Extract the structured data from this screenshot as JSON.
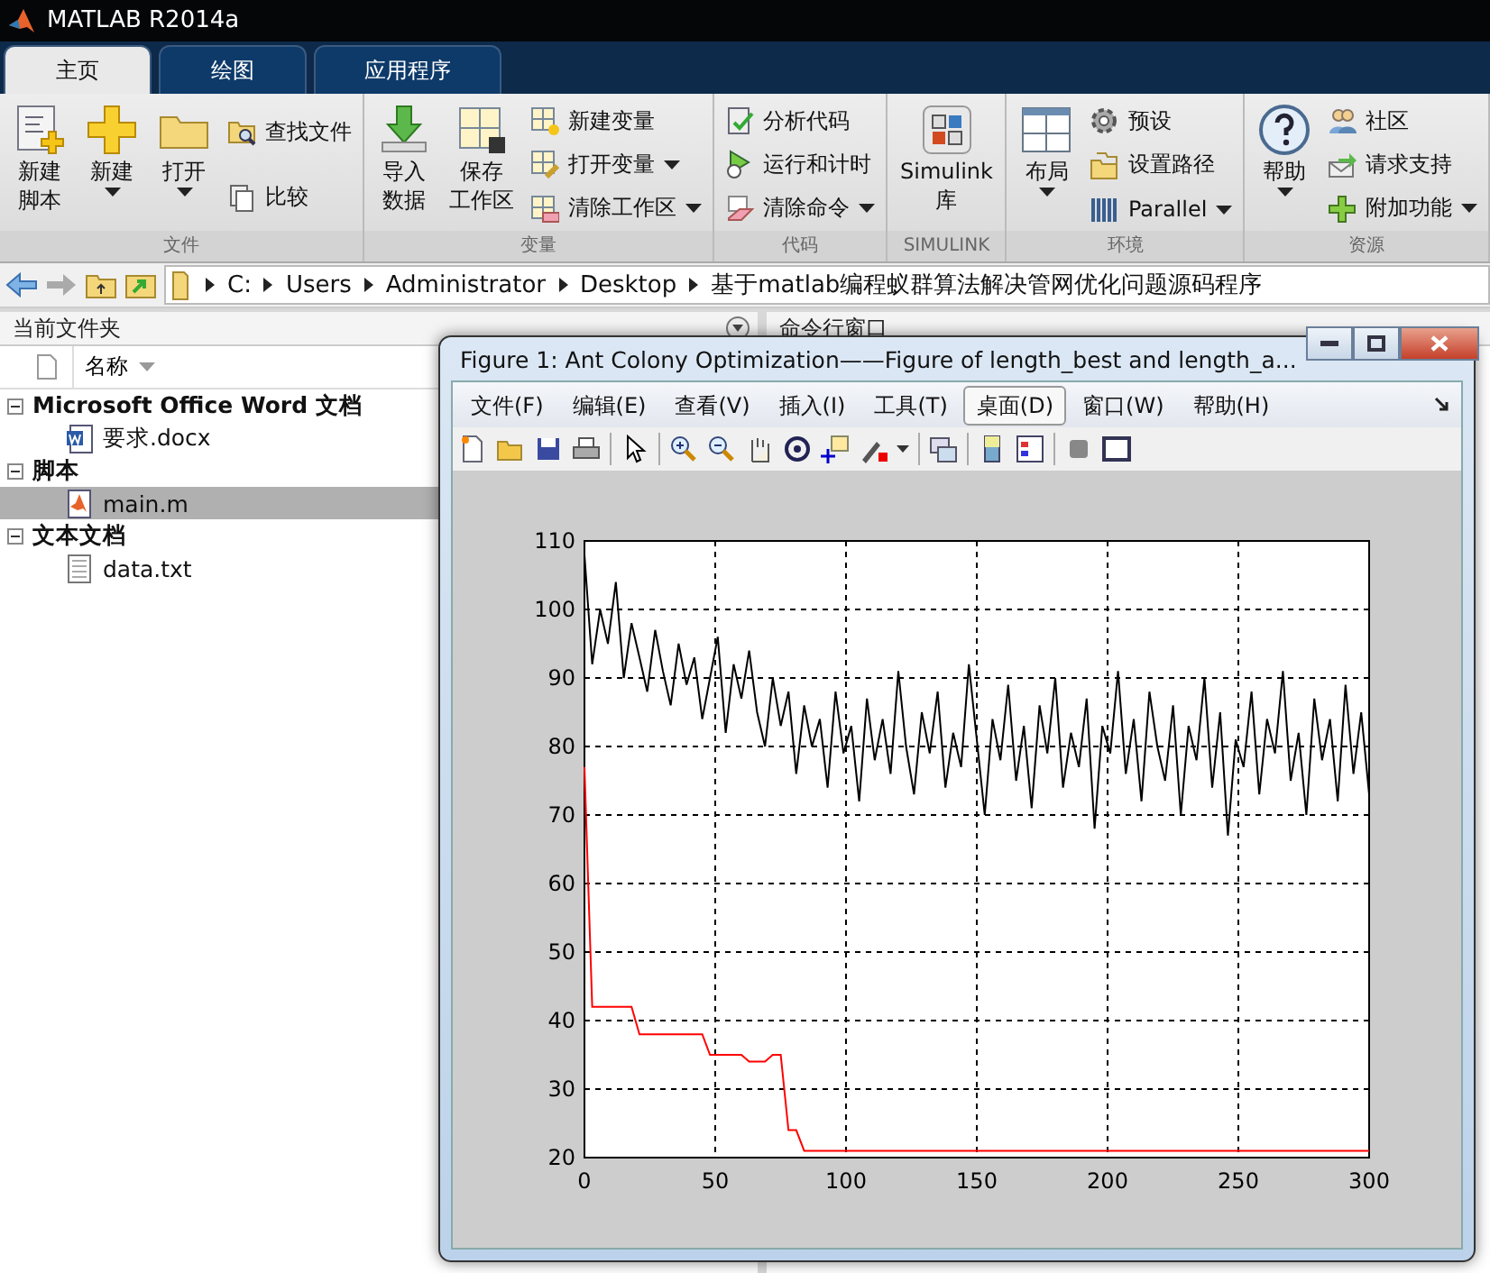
{
  "window": {
    "title": "MATLAB R2014a"
  },
  "tabs": [
    {
      "label": "主页",
      "selected": true
    },
    {
      "label": "绘图",
      "selected": false
    },
    {
      "label": "应用程序",
      "selected": false
    }
  ],
  "ribbon": {
    "groups": [
      {
        "label": "文件",
        "items": [
          {
            "lines": [
              "新建",
              "脚本"
            ],
            "kind": "large",
            "dropdown": false
          },
          {
            "lines": [
              "新建"
            ],
            "kind": "large",
            "dropdown": true
          },
          {
            "lines": [
              "打开"
            ],
            "kind": "large",
            "dropdown": true
          },
          {
            "label": "查找文件",
            "kind": "small",
            "dropdown": false
          },
          {
            "label": "比较",
            "kind": "small",
            "dropdown": false
          }
        ]
      },
      {
        "label": "变量",
        "items": [
          {
            "lines": [
              "导入",
              "数据"
            ],
            "kind": "large",
            "dropdown": false
          },
          {
            "lines": [
              "保存",
              "工作区"
            ],
            "kind": "large",
            "dropdown": false
          },
          {
            "label": "新建变量",
            "kind": "small",
            "dropdown": false
          },
          {
            "label": "打开变量",
            "kind": "small",
            "dropdown": true
          },
          {
            "label": "清除工作区",
            "kind": "small",
            "dropdown": true
          }
        ]
      },
      {
        "label": "代码",
        "items": [
          {
            "label": "分析代码",
            "kind": "small",
            "dropdown": false
          },
          {
            "label": "运行和计时",
            "kind": "small",
            "dropdown": false
          },
          {
            "label": "清除命令",
            "kind": "small",
            "dropdown": true
          }
        ]
      },
      {
        "label": "SIMULINK",
        "items": [
          {
            "lines": [
              "Simulink",
              "库"
            ],
            "kind": "large",
            "dropdown": false
          }
        ]
      },
      {
        "label": "环境",
        "items": [
          {
            "lines": [
              "布局"
            ],
            "kind": "large",
            "dropdown": true
          },
          {
            "label": "预设",
            "kind": "small",
            "dropdown": false
          },
          {
            "label": "设置路径",
            "kind": "small",
            "dropdown": false
          },
          {
            "label": "Parallel",
            "kind": "small",
            "dropdown": true
          }
        ]
      },
      {
        "label": "资源",
        "items": [
          {
            "lines": [
              "帮助"
            ],
            "kind": "large",
            "dropdown": true
          },
          {
            "label": "社区",
            "kind": "small",
            "dropdown": false
          },
          {
            "label": "请求支持",
            "kind": "small",
            "dropdown": false
          },
          {
            "label": "附加功能",
            "kind": "small",
            "dropdown": true
          }
        ]
      }
    ]
  },
  "address": {
    "path": [
      "C:",
      "Users",
      "Administrator",
      "Desktop",
      "基于matlab编程蚁群算法解决管网优化问题源码程序"
    ]
  },
  "folder": {
    "title": "当前文件夹",
    "column": "名称",
    "groups": [
      {
        "label": "Microsoft Office Word 文档",
        "expanded": true,
        "files": [
          {
            "name": "要求.docx",
            "kind": "word",
            "selected": false
          }
        ]
      },
      {
        "label": "脚本",
        "expanded": true,
        "files": [
          {
            "name": "main.m",
            "kind": "script",
            "selected": true
          }
        ]
      },
      {
        "label": "文本文档",
        "expanded": true,
        "files": [
          {
            "name": "data.txt",
            "kind": "text",
            "selected": false
          }
        ]
      }
    ]
  },
  "command_window": {
    "title": "命令行窗口"
  },
  "figure": {
    "title": "Figure 1: Ant Colony Optimization——Figure of length_best and length_a...",
    "menu": [
      {
        "label": "文件(F)",
        "selected": false
      },
      {
        "label": "编辑(E)",
        "selected": false
      },
      {
        "label": "查看(V)",
        "selected": false
      },
      {
        "label": "插入(I)",
        "selected": false
      },
      {
        "label": "工具(T)",
        "selected": false
      },
      {
        "label": "桌面(D)",
        "selected": true
      },
      {
        "label": "窗口(W)",
        "selected": false
      },
      {
        "label": "帮助(H)",
        "selected": false
      }
    ],
    "chart_data": {
      "type": "line",
      "grid": true,
      "xlim": [
        0,
        300
      ],
      "ylim": [
        20,
        110
      ],
      "xticks": [
        0,
        50,
        100,
        150,
        200,
        250,
        300
      ],
      "yticks": [
        20,
        30,
        40,
        50,
        60,
        70,
        80,
        90,
        100,
        110
      ],
      "x": [
        0,
        3,
        6,
        9,
        12,
        15,
        18,
        21,
        24,
        27,
        30,
        33,
        36,
        39,
        42,
        45,
        48,
        51,
        54,
        57,
        60,
        63,
        66,
        69,
        72,
        75,
        78,
        81,
        84,
        87,
        90,
        93,
        96,
        99,
        102,
        105,
        108,
        111,
        114,
        117,
        120,
        123,
        126,
        129,
        132,
        135,
        138,
        141,
        144,
        147,
        150,
        153,
        156,
        159,
        162,
        165,
        168,
        171,
        174,
        177,
        180,
        183,
        186,
        189,
        192,
        195,
        198,
        201,
        204,
        207,
        210,
        213,
        216,
        219,
        222,
        225,
        228,
        231,
        234,
        237,
        240,
        243,
        246,
        249,
        252,
        255,
        258,
        261,
        264,
        267,
        270,
        273,
        276,
        279,
        282,
        285,
        288,
        291,
        294,
        297,
        300
      ],
      "series": [
        {
          "color": "#000000",
          "values": [
            108,
            92,
            100,
            95,
            104,
            90,
            98,
            93,
            88,
            97,
            91,
            86,
            95,
            89,
            93,
            84,
            90,
            96,
            82,
            92,
            87,
            94,
            85,
            80,
            90,
            83,
            88,
            76,
            86,
            80,
            84,
            74,
            88,
            79,
            83,
            72,
            87,
            78,
            84,
            76,
            91,
            80,
            73,
            85,
            79,
            88,
            74,
            82,
            77,
            92,
            81,
            70,
            84,
            78,
            89,
            75,
            83,
            71,
            86,
            79,
            90,
            74,
            82,
            77,
            87,
            68,
            83,
            79,
            91,
            76,
            84,
            72,
            88,
            80,
            75,
            86,
            70,
            83,
            78,
            90,
            74,
            85,
            67,
            81,
            77,
            88,
            73,
            84,
            79,
            91,
            75,
            82,
            70,
            87,
            78,
            84,
            72,
            89,
            76,
            85,
            73
          ]
        },
        {
          "color": "#ff0000",
          "values": [
            77,
            42,
            42,
            42,
            42,
            42,
            42,
            38,
            38,
            38,
            38,
            38,
            38,
            38,
            38,
            38,
            35,
            35,
            35,
            35,
            35,
            34,
            34,
            34,
            35,
            35,
            24,
            24,
            21,
            21,
            21,
            21,
            21,
            21,
            21,
            21,
            21,
            21,
            21,
            21,
            21,
            21,
            21,
            21,
            21,
            21,
            21,
            21,
            21,
            21,
            21,
            21,
            21,
            21,
            21,
            21,
            21,
            21,
            21,
            21,
            21,
            21,
            21,
            21,
            21,
            21,
            21,
            21,
            21,
            21,
            21,
            21,
            21,
            21,
            21,
            21,
            21,
            21,
            21,
            21,
            21,
            21,
            21,
            21,
            21,
            21,
            21,
            21,
            21,
            21,
            21,
            21,
            21,
            21,
            21,
            21,
            21,
            21,
            21,
            21,
            21
          ]
        }
      ]
    }
  }
}
